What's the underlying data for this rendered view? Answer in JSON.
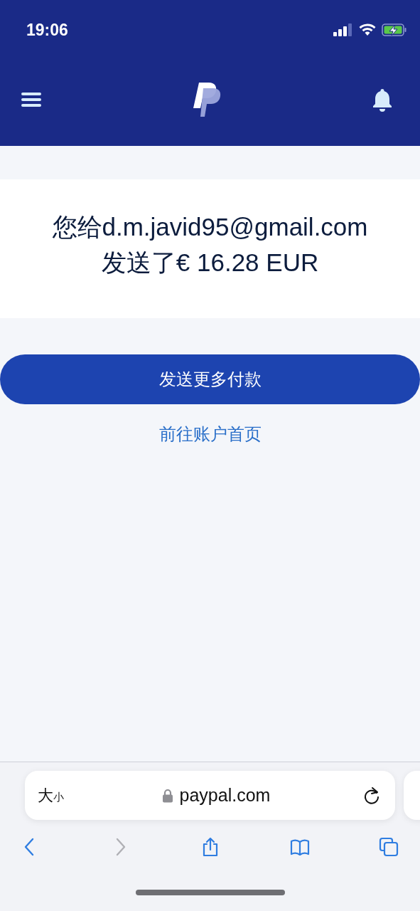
{
  "status_bar": {
    "time": "19:06"
  },
  "confirmation": {
    "lines": [
      "您给d.m.javid95@gmail.com",
      "发送了€ 16.28 EUR"
    ]
  },
  "primary_button": {
    "label": "发送更多付款"
  },
  "secondary_link": {
    "label": "前往账户首页"
  },
  "browser": {
    "text_size": {
      "large": "大",
      "small": "小"
    },
    "address": "paypal.com",
    "nav": [
      {
        "kind": "back",
        "disabled": false
      },
      {
        "kind": "forward",
        "disabled": true
      },
      {
        "kind": "share",
        "disabled": false
      },
      {
        "kind": "bookmarks",
        "disabled": false
      },
      {
        "kind": "tabs",
        "disabled": false
      }
    ]
  }
}
